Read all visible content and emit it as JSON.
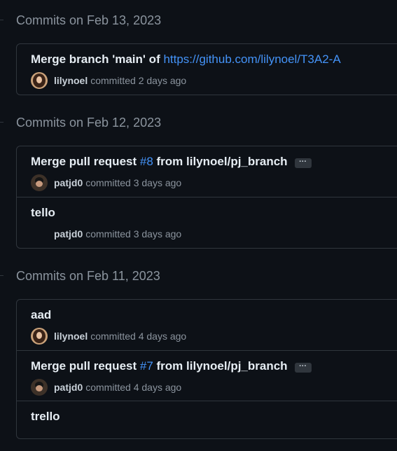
{
  "groups": [
    {
      "title": "Commits on Feb 13, 2023",
      "commits": [
        {
          "message": "Merge branch 'main' of ",
          "link": "https://github.com/lilynoel/T3A2-A",
          "author": "lilynoel",
          "time": "committed 2 days ago"
        }
      ]
    },
    {
      "title": "Commits on Feb 12, 2023",
      "commits": [
        {
          "message_prefix": "Merge pull request ",
          "pr": "#8",
          "message_suffix": " from lilynoel/pj_branch",
          "ellipsis": "···",
          "author": "patjd0",
          "time": "committed 3 days ago"
        },
        {
          "message": "tello",
          "author": "patjd0",
          "time": "committed 3 days ago"
        }
      ]
    },
    {
      "title": "Commits on Feb 11, 2023",
      "commits": [
        {
          "message": "aad",
          "author": "lilynoel",
          "time": "committed 4 days ago"
        },
        {
          "message_prefix": "Merge pull request ",
          "pr": "#7",
          "message_suffix": " from lilynoel/pj_branch",
          "ellipsis": "···",
          "author": "patjd0",
          "time": "committed 4 days ago"
        },
        {
          "message": "trello"
        }
      ]
    }
  ]
}
